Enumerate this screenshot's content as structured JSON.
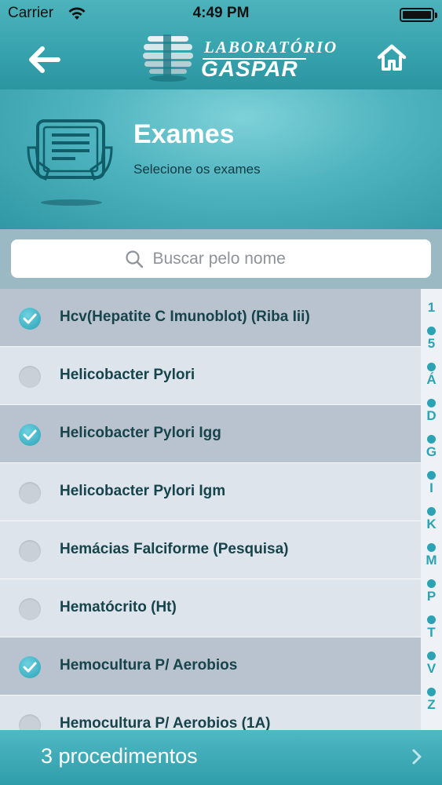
{
  "status_bar": {
    "carrier": "Carrier",
    "time": "4:49 PM"
  },
  "nav": {
    "back_icon": "arrow-left-icon",
    "home_icon": "home-icon",
    "logo": {
      "line1": "LABORATÓRIO",
      "line2": "GASPAR"
    }
  },
  "header": {
    "title": "Exames",
    "subtitle": "Selecione os exames",
    "icon": "tablet-hands-icon"
  },
  "search": {
    "placeholder": "Buscar pelo nome",
    "value": ""
  },
  "exams": [
    {
      "name": "Hcv(Hepatite C Imunoblot) (Riba Iii)",
      "selected": true
    },
    {
      "name": "Helicobacter Pylori",
      "selected": false
    },
    {
      "name": "Helicobacter Pylori Igg",
      "selected": true
    },
    {
      "name": "Helicobacter Pylori Igm",
      "selected": false
    },
    {
      "name": "Hemácias Falciforme (Pesquisa)",
      "selected": false
    },
    {
      "name": "Hematócrito (Ht)",
      "selected": false
    },
    {
      "name": "Hemocultura P/ Aerobios",
      "selected": true
    },
    {
      "name": "Hemocultura P/ Aerobios (1A)",
      "selected": false
    }
  ],
  "index_letters": [
    "1",
    "5",
    "Á",
    "D",
    "G",
    "I",
    "K",
    "M",
    "P",
    "T",
    "V",
    "Z"
  ],
  "footer": {
    "label": "3 procedimentos"
  },
  "colors": {
    "accent": "#2ba3b5",
    "header": "#36a2ad",
    "row": "#dde4ec",
    "row_selected": "#b9c3cf",
    "text": "#17434b"
  }
}
